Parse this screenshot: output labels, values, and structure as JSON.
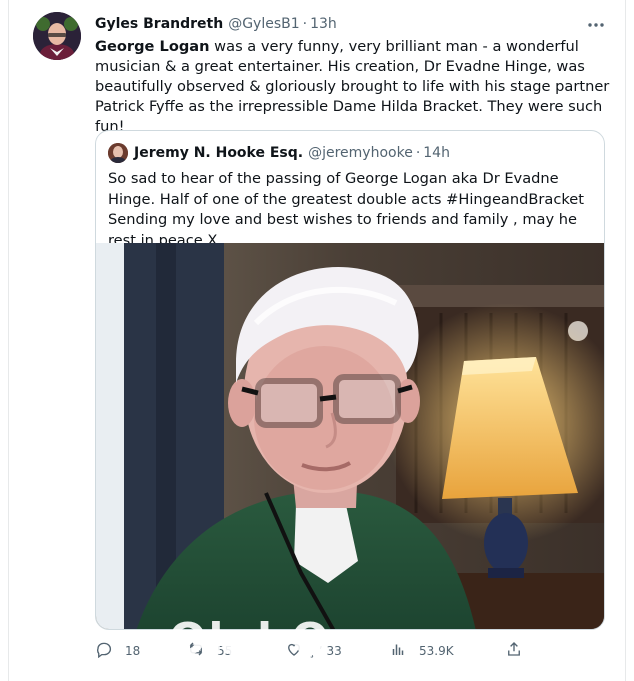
{
  "tweet": {
    "author_name": "Gyles Brandreth",
    "author_handle": "@GylesB1",
    "dot": "·",
    "time": "13h",
    "text_bold": "George Logan",
    "text_rest": " was a very funny, very brilliant man - a wonderful musician & a great entertainer. His creation, Dr Evadne Hinge, was beautifully observed & gloriously brought to life with his stage partner Patrick Fyffe as the irrepressible Dame Hilda Bracket. They were such fun!",
    "more_icon": "more-horizontal-icon"
  },
  "quote": {
    "author_name": "Jeremy N. Hooke Esq.",
    "author_handle": "@jeremyhooke",
    "dot": "·",
    "time": "14h",
    "text": "So sad to hear of the passing of George Logan aka Dr Evadne Hinge. Half of one of the greatest double acts #HingeandBracket Sending my love and best wishes to friends and family , may he rest in peace X"
  },
  "actions": {
    "replies": "18",
    "retweets": "55",
    "likes": "̧ ʼ 33",
    "views": "53.9K"
  },
  "overlay": {
    "text": "Ok l  O"
  },
  "colors": {
    "text_primary": "#0f1419",
    "text_secondary": "#536471",
    "border": "#cfd9de"
  }
}
